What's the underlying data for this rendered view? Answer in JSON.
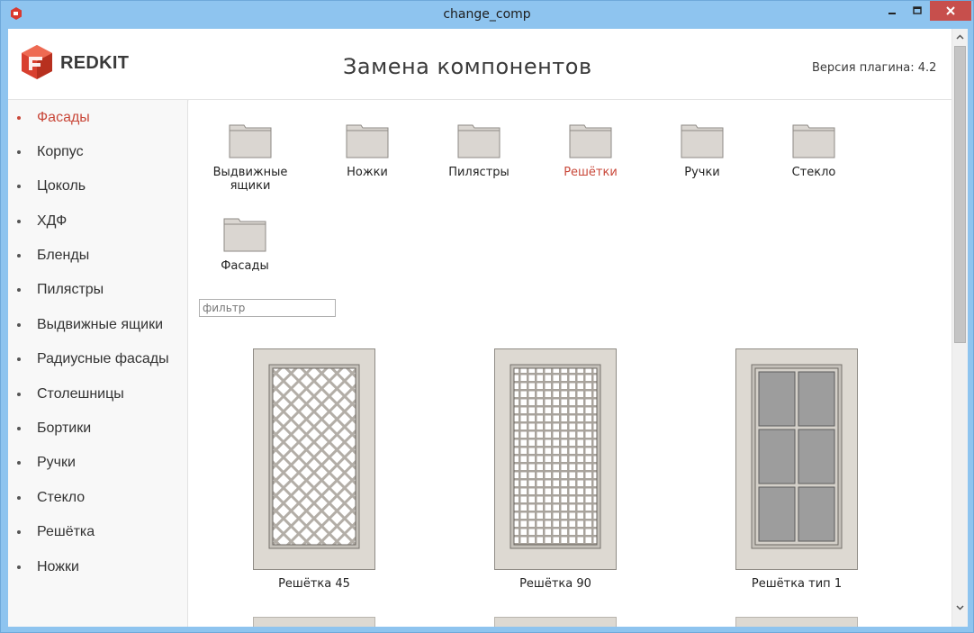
{
  "window": {
    "title": "change_comp"
  },
  "header": {
    "brand": "REDKIT",
    "title": "Замена компонентов",
    "version": "Версия плагина: 4.2"
  },
  "sidebar": {
    "items": [
      {
        "label": "Фасады",
        "active": true
      },
      {
        "label": "Корпус"
      },
      {
        "label": "Цоколь"
      },
      {
        "label": "ХДФ"
      },
      {
        "label": "Бленды"
      },
      {
        "label": "Пилястры"
      },
      {
        "label": "Выдвижные ящики"
      },
      {
        "label": "Радиусные фасады"
      },
      {
        "label": "Столешницы"
      },
      {
        "label": "Бортики"
      },
      {
        "label": "Ручки"
      },
      {
        "label": "Стекло"
      },
      {
        "label": "Решётка"
      },
      {
        "label": "Ножки"
      }
    ]
  },
  "folders": [
    {
      "label": "Выдвижные ящики"
    },
    {
      "label": "Ножки"
    },
    {
      "label": "Пилястры"
    },
    {
      "label": "Решётки",
      "active": true
    },
    {
      "label": "Ручки"
    },
    {
      "label": "Стекло"
    },
    {
      "label": "Фасады"
    }
  ],
  "filter": {
    "placeholder": "фильтр",
    "value": ""
  },
  "components": [
    {
      "label": "Решётка 45",
      "pattern": "diagonal-lattice"
    },
    {
      "label": "Решётка 90",
      "pattern": "square-lattice"
    },
    {
      "label": "Решётка тип 1",
      "pattern": "glass-panes"
    }
  ],
  "colors": {
    "accent": "#c9483a",
    "titlebar": "#8ec4ef",
    "close_button": "#c74f4c",
    "frame": "#ddd9d2",
    "pane": "#9d9d9d"
  }
}
